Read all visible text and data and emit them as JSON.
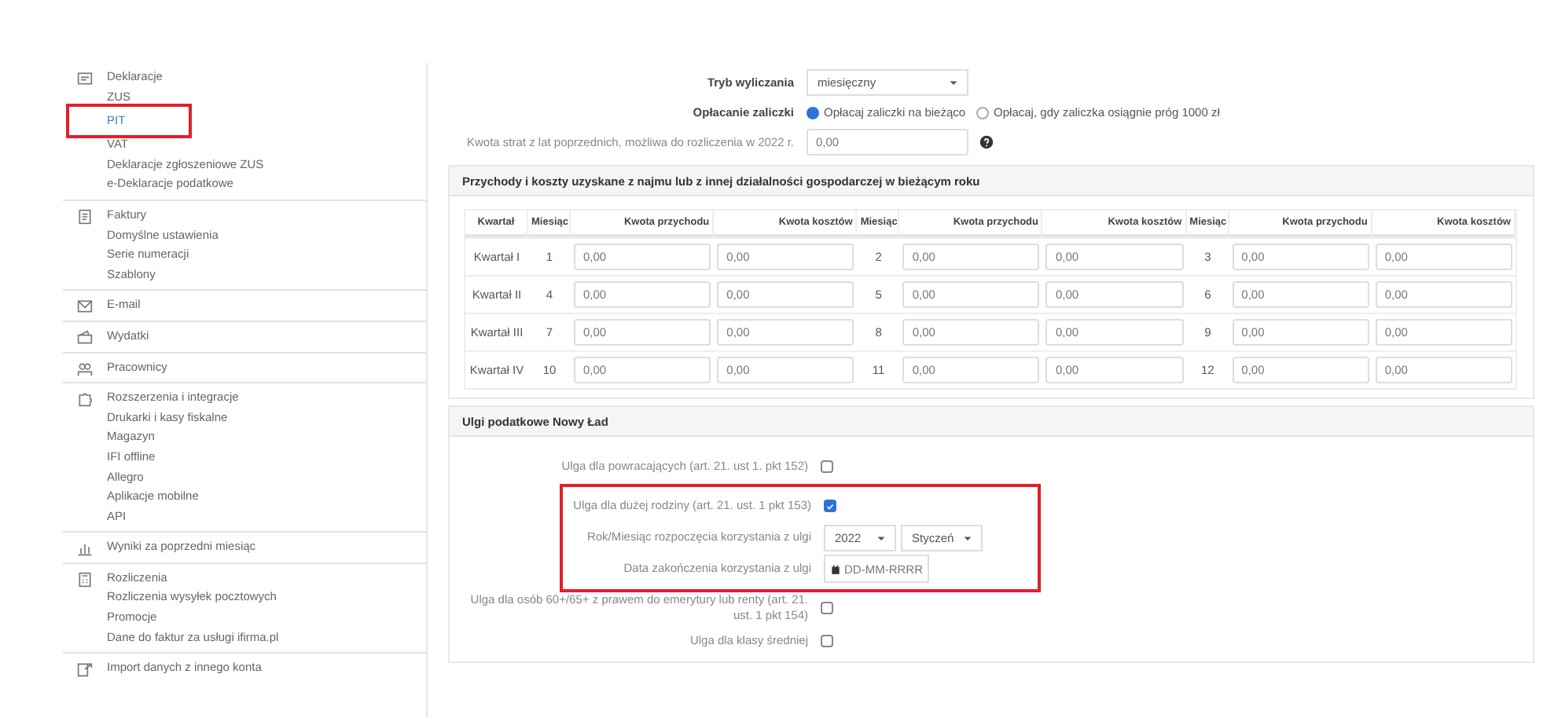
{
  "sidebar": {
    "groups": [
      {
        "items": [
          {
            "label": "Deklaracje",
            "selected": false,
            "highlighted": false
          },
          {
            "label": "ZUS",
            "selected": false,
            "highlighted": false
          },
          {
            "label": "PIT",
            "selected": true,
            "highlighted": true
          },
          {
            "label": "VAT",
            "selected": false,
            "highlighted": false
          },
          {
            "label": "Deklaracje zgłoszeniowe ZUS",
            "selected": false,
            "highlighted": false
          },
          {
            "label": "e-Deklaracje podatkowe",
            "selected": false,
            "highlighted": false
          }
        ]
      },
      {
        "items": [
          {
            "label": "Faktury",
            "selected": false,
            "highlighted": false
          },
          {
            "label": "Domyślne ustawienia",
            "selected": false,
            "highlighted": false
          },
          {
            "label": "Serie numeracji",
            "selected": false,
            "highlighted": false
          },
          {
            "label": "Szablony",
            "selected": false,
            "highlighted": false
          }
        ]
      },
      {
        "items": [
          {
            "label": "E-mail",
            "selected": false,
            "highlighted": false
          }
        ]
      },
      {
        "items": [
          {
            "label": "Wydatki",
            "selected": false,
            "highlighted": false
          }
        ]
      },
      {
        "items": [
          {
            "label": "Pracownicy",
            "selected": false,
            "highlighted": false
          }
        ]
      },
      {
        "items": [
          {
            "label": "Rozszerzenia i integracje",
            "selected": false,
            "highlighted": false
          },
          {
            "label": "Drukarki i kasy fiskalne",
            "selected": false,
            "highlighted": false
          },
          {
            "label": "Magazyn",
            "selected": false,
            "highlighted": false
          },
          {
            "label": "IFI offline",
            "selected": false,
            "highlighted": false
          },
          {
            "label": "Allegro",
            "selected": false,
            "highlighted": false
          },
          {
            "label": "Aplikacje mobilne",
            "selected": false,
            "highlighted": false
          },
          {
            "label": "API",
            "selected": false,
            "highlighted": false
          }
        ]
      },
      {
        "items": [
          {
            "label": "Wyniki za poprzedni miesiąc",
            "selected": false,
            "highlighted": false
          }
        ]
      },
      {
        "items": [
          {
            "label": "Rozliczenia",
            "selected": false,
            "highlighted": false
          },
          {
            "label": "Rozliczenia wysyłek pocztowych",
            "selected": false,
            "highlighted": false
          },
          {
            "label": "Promocje",
            "selected": false,
            "highlighted": false
          },
          {
            "label": "Dane do faktur za usługi ifirma.pl",
            "selected": false,
            "highlighted": false
          }
        ]
      },
      {
        "items": [
          {
            "label": "Import danych z innego konta",
            "selected": false,
            "highlighted": false
          }
        ]
      }
    ]
  },
  "settings": {
    "mode": {
      "label": "Tryb wyliczania",
      "value": "miesięczny"
    },
    "advance": {
      "label": "Opłacanie zaliczki",
      "options": [
        {
          "label": "Opłacaj zaliczki na bieżąco",
          "selected": true
        },
        {
          "label": "Opłacaj, gdy zaliczka osiągnie próg 1000 zł",
          "selected": false
        }
      ]
    },
    "losses": {
      "label": "Kwota strat z lat poprzednich, możliwa do rozliczenia w 2022 r.",
      "value": "0,00"
    }
  },
  "income_panel": {
    "title": "Przychody i koszty uzyskane z najmu lub z innej działalności gospodarczej w bieżącym roku",
    "columns": [
      "Kwartał",
      "Miesiąc",
      "Kwota przychodu",
      "Kwota kosztów",
      "Miesiąc",
      "Kwota przychodu",
      "Kwota kosztów",
      "Miesiąc",
      "Kwota przychodu",
      "Kwota kosztów"
    ],
    "rows": [
      {
        "quarter": "Kwartał I",
        "months": [
          {
            "month": "1",
            "income": "0,00",
            "costs": "0,00"
          },
          {
            "month": "2",
            "income": "0,00",
            "costs": "0,00"
          },
          {
            "month": "3",
            "income": "0,00",
            "costs": "0,00"
          }
        ]
      },
      {
        "quarter": "Kwartał II",
        "months": [
          {
            "month": "4",
            "income": "0,00",
            "costs": "0,00"
          },
          {
            "month": "5",
            "income": "0,00",
            "costs": "0,00"
          },
          {
            "month": "6",
            "income": "0,00",
            "costs": "0,00"
          }
        ]
      },
      {
        "quarter": "Kwartał III",
        "months": [
          {
            "month": "7",
            "income": "0,00",
            "costs": "0,00"
          },
          {
            "month": "8",
            "income": "0,00",
            "costs": "0,00"
          },
          {
            "month": "9",
            "income": "0,00",
            "costs": "0,00"
          }
        ]
      },
      {
        "quarter": "Kwartał IV",
        "months": [
          {
            "month": "10",
            "income": "0,00",
            "costs": "0,00"
          },
          {
            "month": "11",
            "income": "0,00",
            "costs": "0,00"
          },
          {
            "month": "12",
            "income": "0,00",
            "costs": "0,00"
          }
        ]
      }
    ]
  },
  "reliefs_panel": {
    "title": "Ulgi podatkowe Nowy Ład",
    "rows": [
      {
        "kind": "checkbox",
        "label": "Ulga dla powracających (art. 21. ust 1. pkt 152)",
        "checked": false,
        "highlighted": false
      },
      {
        "kind": "checkbox",
        "label": "Ulga dla dużej rodziny (art. 21. ust. 1 pkt 153)",
        "checked": true,
        "highlighted": true
      },
      {
        "kind": "selects",
        "label": "Rok/Miesiąc rozpoczęcia korzystania z ulgi",
        "values": [
          "2022",
          "Styczeń"
        ],
        "highlighted": true
      },
      {
        "kind": "date",
        "label": "Data zakończenia korzystania z ulgi",
        "placeholder": "DD-MM-RRRR",
        "highlighted": true
      },
      {
        "kind": "checkbox",
        "label": "Ulga dla osób 60+/65+ z prawem do emerytury lub renty (art. 21. ust. 1 pkt 154)",
        "checked": false,
        "highlighted": false
      },
      {
        "kind": "checkbox",
        "label": "Ulga dla klasy średniej",
        "checked": false,
        "highlighted": false
      }
    ]
  }
}
